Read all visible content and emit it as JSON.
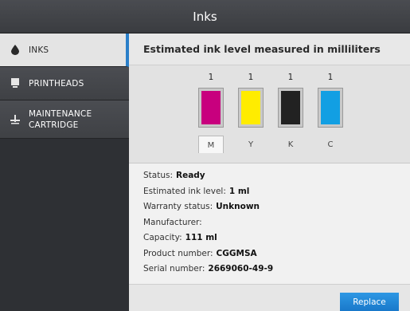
{
  "window": {
    "title": "Inks"
  },
  "sidebar": {
    "items": [
      {
        "label": "INKS",
        "icon": "ink-drop-icon",
        "active": true
      },
      {
        "label": "PRINTHEADS",
        "icon": "printhead-icon",
        "active": false
      },
      {
        "label": "MAINTENANCE\nCARTRIDGE",
        "icon": "maintenance-icon",
        "active": false
      }
    ]
  },
  "main": {
    "heading": "Estimated ink level measured in milliliters",
    "cartridges": [
      {
        "letter": "M",
        "count": "1",
        "color": "#c8007e",
        "selected": true
      },
      {
        "letter": "Y",
        "count": "1",
        "color": "#ffec00",
        "selected": false
      },
      {
        "letter": "K",
        "count": "1",
        "color": "#222222",
        "selected": false
      },
      {
        "letter": "C",
        "count": "1",
        "color": "#129fe3",
        "selected": false
      }
    ],
    "details": {
      "status": {
        "label": "Status:",
        "value": "Ready"
      },
      "ink_level": {
        "label": "Estimated ink level:",
        "value": "1 ml"
      },
      "warranty": {
        "label": "Warranty status:",
        "value": "Unknown"
      },
      "manufacturer": {
        "label": "Manufacturer:",
        "value": ""
      },
      "capacity": {
        "label": "Capacity:",
        "value": "111 ml"
      },
      "product_number": {
        "label": "Product number:",
        "value": "CGGMSA"
      },
      "serial_number": {
        "label": "Serial number:",
        "value": "2669060-49-9"
      }
    }
  },
  "footer": {
    "replace_label": "Replace"
  },
  "colors": {
    "accent": "#2a7fc9",
    "button": "#1e86d6"
  }
}
